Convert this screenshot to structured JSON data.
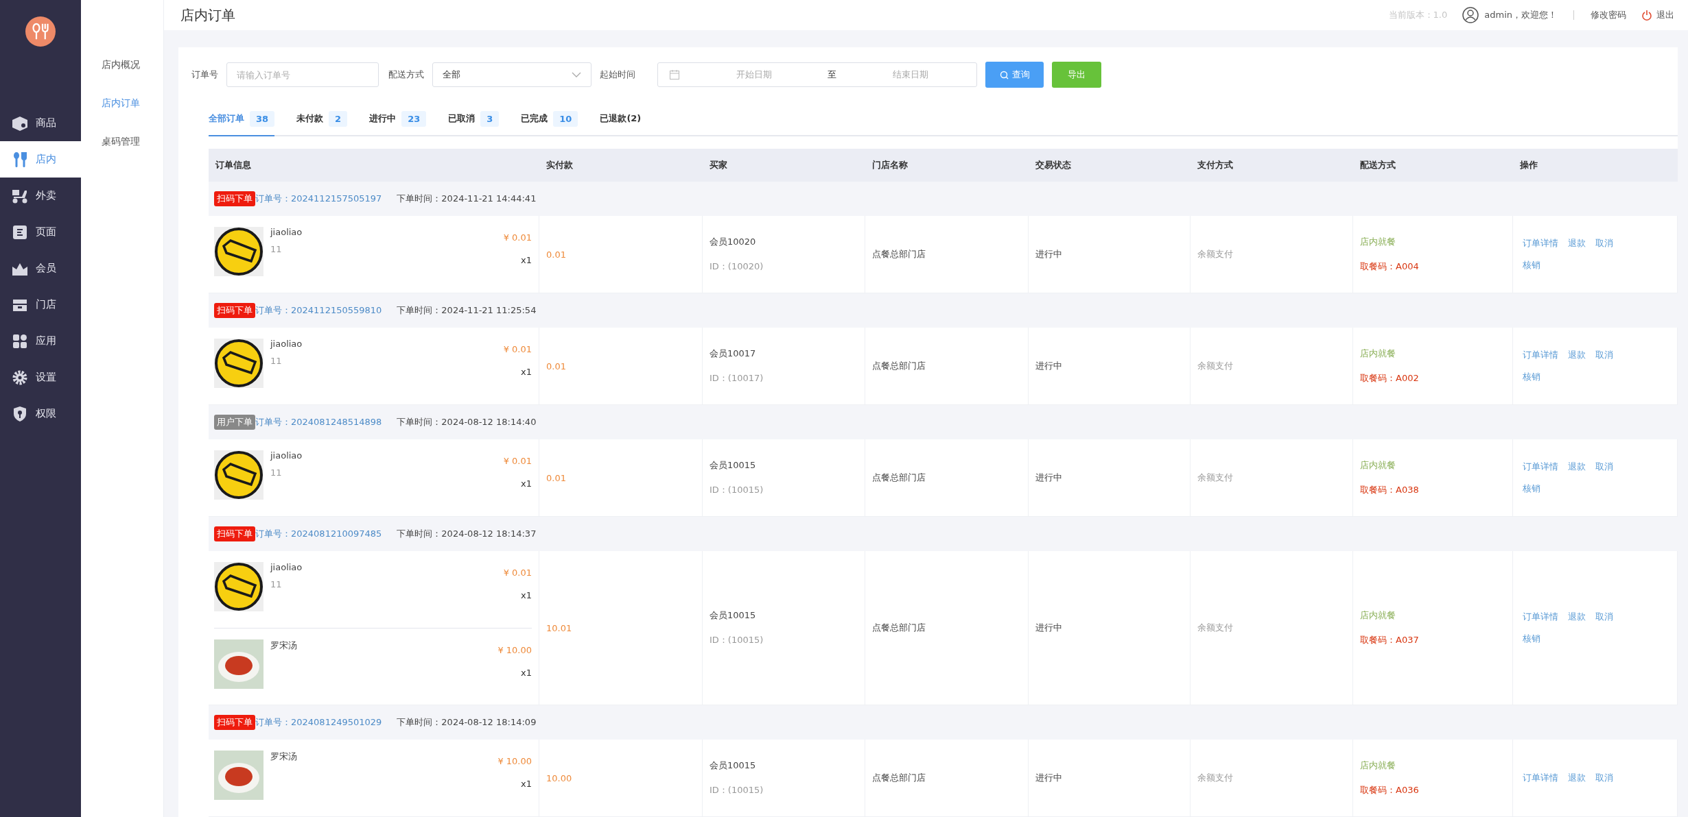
{
  "sidebar": {
    "items": [
      {
        "label": "商品",
        "selected": false
      },
      {
        "label": "店内",
        "selected": true
      },
      {
        "label": "外卖",
        "selected": false
      },
      {
        "label": "页面",
        "selected": false
      },
      {
        "label": "会员",
        "selected": false
      },
      {
        "label": "门店",
        "selected": false
      },
      {
        "label": "应用",
        "selected": false
      },
      {
        "label": "设置",
        "selected": false
      },
      {
        "label": "权限",
        "selected": false
      }
    ]
  },
  "subnav": [
    {
      "label": "店内概况",
      "selected": false
    },
    {
      "label": "店内订单",
      "selected": true
    },
    {
      "label": "桌码管理",
      "selected": false
    }
  ],
  "header": {
    "title": "店内订单",
    "version": "当前版本：1.0",
    "user": "admin，欢迎您！",
    "change_password": "修改密码",
    "logout": "退出"
  },
  "filters": {
    "order_no_label": "订单号",
    "order_no_placeholder": "请输入订单号",
    "delivery_label": "配送方式",
    "delivery_value": "全部",
    "time_label": "起始时间",
    "start_placeholder": "开始日期",
    "range_separator": "至",
    "end_placeholder": "结束日期",
    "search_button": "查询",
    "export_button": "导出"
  },
  "tabs": [
    {
      "label": "全部订单",
      "count": "38",
      "selected": true
    },
    {
      "label": "未付款",
      "count": "2",
      "selected": false
    },
    {
      "label": "进行中",
      "count": "23",
      "selected": false
    },
    {
      "label": "已取消",
      "count": "3",
      "selected": false
    },
    {
      "label": "已完成",
      "count": "10",
      "selected": false
    },
    {
      "label": "已退款(2)",
      "selected": false
    }
  ],
  "table": {
    "columns": [
      "订单信息",
      "实付款",
      "买家",
      "门店名称",
      "交易状态",
      "支付方式",
      "配送方式",
      "操作"
    ],
    "orders": [
      {
        "source": "扫码下单",
        "kind": "scan",
        "order_no": "订单号：2024112157505197",
        "order_time": "下单时间：2024-11-21 14:44:41",
        "items": [
          {
            "kind": "sticker",
            "name": "jiaoliao",
            "spec": "11",
            "price": "¥ 0.01",
            "qty": "x1"
          }
        ],
        "paid": "0.01",
        "buyer": "会员10020",
        "buyer_id": "ID：(10020)",
        "store": "点餐总部门店",
        "status": "进行中",
        "payment": "余额支付",
        "delivery": "店内就餐",
        "pickup_code": "取餐码：A004",
        "actions": [
          "订单详情",
          "退款",
          "取消",
          "核销"
        ]
      },
      {
        "source": "扫码下单",
        "kind": "scan",
        "order_no": "订单号：2024112150559810",
        "order_time": "下单时间：2024-11-21 11:25:54",
        "items": [
          {
            "kind": "sticker",
            "name": "jiaoliao",
            "spec": "11",
            "price": "¥ 0.01",
            "qty": "x1"
          }
        ],
        "paid": "0.01",
        "buyer": "会员10017",
        "buyer_id": "ID：(10017)",
        "store": "点餐总部门店",
        "status": "进行中",
        "payment": "余额支付",
        "delivery": "店内就餐",
        "pickup_code": "取餐码：A002",
        "actions": [
          "订单详情",
          "退款",
          "取消",
          "核销"
        ]
      },
      {
        "source": "用户下单",
        "kind": "user",
        "order_no": "订单号：2024081248514898",
        "order_time": "下单时间：2024-08-12 18:14:40",
        "items": [
          {
            "kind": "sticker",
            "name": "jiaoliao",
            "spec": "11",
            "price": "¥ 0.01",
            "qty": "x1"
          }
        ],
        "paid": "0.01",
        "buyer": "会员10015",
        "buyer_id": "ID：(10015)",
        "store": "点餐总部门店",
        "status": "进行中",
        "payment": "余额支付",
        "delivery": "店内就餐",
        "pickup_code": "取餐码：A038",
        "actions": [
          "订单详情",
          "退款",
          "取消",
          "核销"
        ]
      },
      {
        "source": "扫码下单",
        "kind": "scan",
        "order_no": "订单号：2024081210097485",
        "order_time": "下单时间：2024-08-12 18:14:37",
        "items": [
          {
            "kind": "sticker",
            "name": "jiaoliao",
            "spec": "11",
            "price": "¥ 0.01",
            "qty": "x1"
          },
          {
            "kind": "soup",
            "name": "罗宋汤",
            "price": "¥ 10.00",
            "qty": "x1"
          }
        ],
        "paid": "10.01",
        "buyer": "会员10015",
        "buyer_id": "ID：(10015)",
        "store": "点餐总部门店",
        "status": "进行中",
        "payment": "余额支付",
        "delivery": "店内就餐",
        "pickup_code": "取餐码：A037",
        "actions": [
          "订单详情",
          "退款",
          "取消",
          "核销"
        ]
      },
      {
        "source": "扫码下单",
        "kind": "scan",
        "order_no": "订单号：2024081249501029",
        "order_time": "下单时间：2024-08-12 18:14:09",
        "items": [
          {
            "kind": "soup",
            "name": "罗宋汤",
            "price": "¥ 10.00",
            "qty": "x1"
          }
        ],
        "paid": "10.00",
        "buyer": "会员10015",
        "buyer_id": "ID：(10015)",
        "store": "点餐总部门店",
        "status": "进行中",
        "payment": "余额支付",
        "delivery": "店内就餐",
        "pickup_code": "取餐码：A036",
        "actions": [
          "订单详情",
          "退款",
          "取消"
        ]
      }
    ]
  }
}
